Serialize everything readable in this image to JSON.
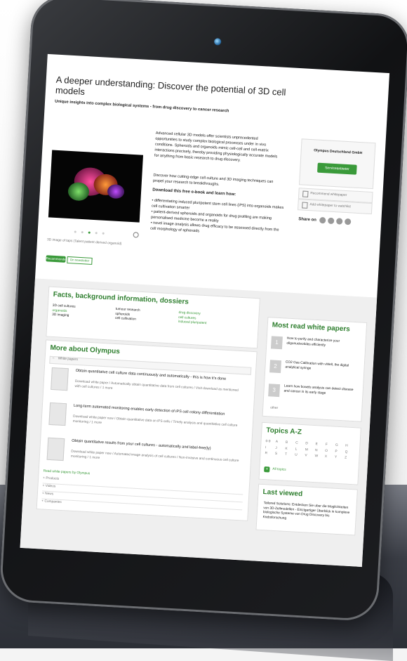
{
  "article": {
    "title": "A deeper understanding: Discover the potential of 3D cell models",
    "subtitle": "Unique insights into complex biological systems - from drug discovery to cancer research",
    "image_caption": "3D image of taps (Talent patient derived organoid)",
    "para1": "Advanced cellular 3D models offer scientists unprecedented opportunities to study complex biological processes under in vivo conditions. Spheroids and organoids mimic cell-cell and cell-matrix interactions precisely, thereby providing physiologically accurate models for anything from basic research to drug discovery.",
    "para2": "Discover how cutting-edge cell culture and 3D imaging techniques can propel your research to breakthroughs.",
    "download_heading": "Download this free e-book and learn how:",
    "bullets": [
      "differentiating induced pluripotent stem cell lines (iPS) into organoids makes cell cultivation smarter",
      "patient-derived spheroids and organoids for drug profiling are making personalised medicine become a reality",
      "novel image analysis allows drug efficacy to be assessed directly from the cell morphology of spheroids"
    ],
    "tab_recommended": "Recommended",
    "tab_newsletter": "On newsletter"
  },
  "sidebar_box": {
    "company": "Olympus Deutschland GmbH",
    "contact_button": "Serviceanbieter",
    "recommend": "Recommend whitepaper",
    "watchlist": "Add whitepaper to watchlist",
    "share_label": "Share on"
  },
  "facts": {
    "title": "Facts, background information, dossiers",
    "col1": [
      "3D cell cultures",
      "organoids",
      "3D imaging"
    ],
    "col2": [
      "tumour research",
      "spheroids",
      "cell cultivation"
    ],
    "col3": [
      "drug discovery",
      "cell cultures",
      "induced pluripotent"
    ]
  },
  "more": {
    "title": "More about Olympus",
    "section": "White papers",
    "items": [
      {
        "title": "Obtain quantitative cell culture data continuously and automatically - this is how it's done",
        "meta": "Download white paper / Automatically obtain quantitative data from cell cultures / Visit download as mentioned with cell cultures / 1 more"
      },
      {
        "title": "Long-term automated monitoring enables early detection of iPS cell colony differentiation",
        "meta": "Download white paper now / Obtain quantitative data on iPS cells / Timely analysis and quantitative cell culture monitoring / 1 more"
      },
      {
        "title": "Obtain quantitative results from your cell cultures - automatically and label-free(ly)",
        "meta": "Download white paper now / Automated image analysis of cell cultures / Non-invasive and continuous cell culture monitoring / 1 more"
      }
    ],
    "more_link": "Read white papers by Olympus",
    "collapsed": [
      "Products",
      "Videos",
      "News",
      "Companies"
    ]
  },
  "most_read": {
    "title": "Most read white papers",
    "items": [
      "How to purify and characterize your oligonucleotides efficiently",
      "CO2 Gas Calibration with vWell, the digital analytical syringe",
      "Learn how bowels analysis can detect disease and cancer in its early stage"
    ],
    "other": "other"
  },
  "topics": {
    "title": "Topics A-Z",
    "letters": [
      "0-9",
      "A",
      "B",
      "C",
      "D",
      "E",
      "F",
      "G",
      "H",
      "I",
      "J",
      "K",
      "L",
      "M",
      "N",
      "O",
      "P",
      "Q",
      "R",
      "S",
      "T",
      "U",
      "V",
      "W",
      "X",
      "Y",
      "Z"
    ],
    "all": "All topics"
  },
  "last_viewed": {
    "title": "Last viewed",
    "text": "Tailored Solutions: Entdecken Sie uber die Moglichkeiten von 3D-Zellmodellen - Einzigartiger Überblick in komplexe biologische Systeme von Drug Discovery bis Krebsforschung"
  }
}
